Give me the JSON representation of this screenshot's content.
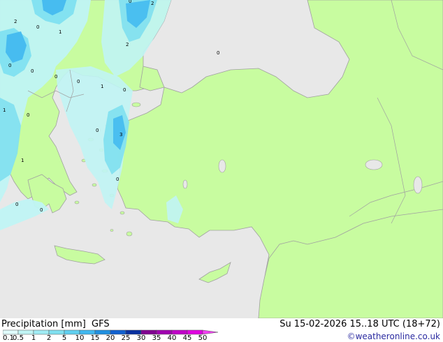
{
  "legend": {
    "title": "Precipitation [mm]",
    "model": "GFS",
    "datetime": "Su 15-02-2026 15..18 UTC (18+72)",
    "credit": "©weatheronline.co.uk",
    "scale": {
      "labels": [
        "0.1",
        "0.5",
        "1",
        "2",
        "5",
        "10",
        "15",
        "20",
        "25",
        "30",
        "35",
        "40",
        "45",
        "50"
      ],
      "colors": [
        "#e0fcfc",
        "#c0f4f4",
        "#a0ecf4",
        "#80e0f0",
        "#60d0f0",
        "#40b8f0",
        "#2090e0",
        "#1060d0",
        "#0830a0",
        "#800090",
        "#a000b0",
        "#c000c8",
        "#e000e0",
        "#f040f0"
      ]
    }
  },
  "map": {
    "colors": {
      "sea": "#e8e8e8",
      "land": "#c8fca0",
      "border": "#a0a0a0",
      "precip_light": "#c0f4f4",
      "precip_mid": "#80e0f0",
      "precip_strong": "#40b8f0"
    },
    "labels": [
      "2",
      "0",
      "1",
      "0",
      "1",
      "0",
      "0",
      "1",
      "0",
      "0",
      "0",
      "0",
      "0",
      "1",
      "0",
      "3",
      "1",
      "0",
      "0",
      "2",
      "2",
      "0"
    ]
  }
}
